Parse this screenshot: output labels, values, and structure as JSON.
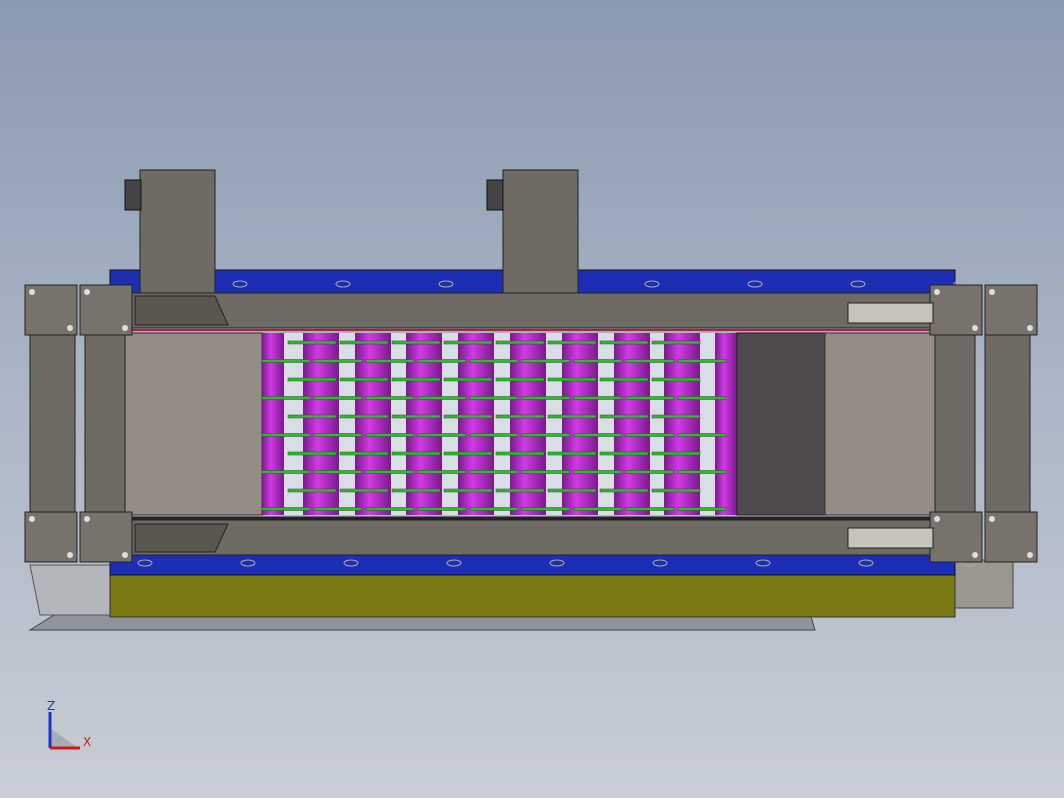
{
  "triad": {
    "z_label": "Z",
    "x_label": "X",
    "z_color": "#1a33cc",
    "x_color": "#cc1a1a"
  },
  "colors": {
    "background_top": "#8a9ab0",
    "background_bottom": "#c8cdd6",
    "frame_gray": "#6e6a64",
    "blue_rail": "#1c2fb4",
    "magenta_roller": "#b42ac8",
    "green_rod": "#39b439",
    "olive_base": "#7b7a12",
    "dark_panel": "#4f4a4d",
    "light_panel": "#958c88"
  }
}
